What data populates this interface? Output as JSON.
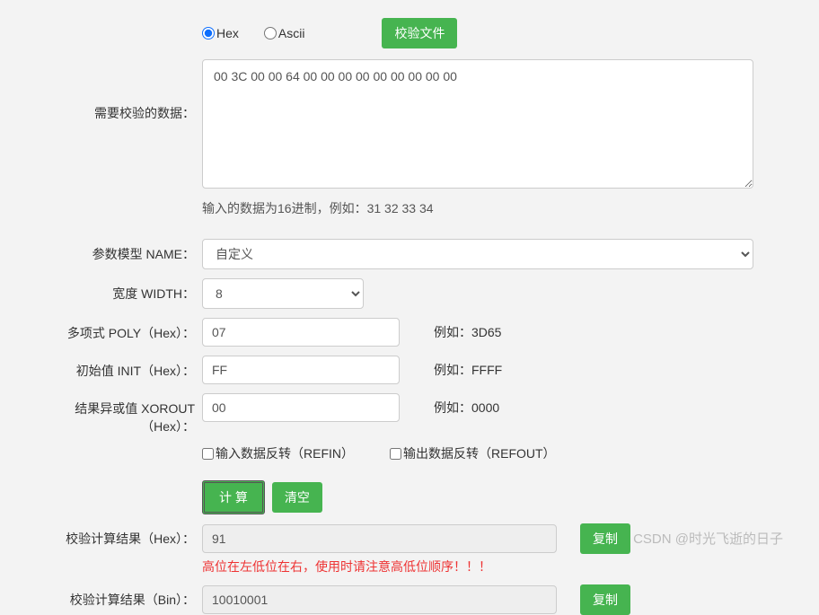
{
  "format": {
    "hex_label": "Hex",
    "ascii_label": "Ascii",
    "selected": "hex",
    "verify_file_button": "校验文件"
  },
  "input": {
    "label": "需要校验的数据：",
    "value": "00 3C 00 00 64 00 00 00 00 00 00 00 00 00",
    "hint": "输入的数据为16进制，例如：31 32 33 34"
  },
  "params": {
    "name_label": "参数模型 NAME：",
    "name_value": "自定义",
    "width_label": "宽度 WIDTH：",
    "width_value": "8",
    "poly_label": "多项式 POLY（Hex）：",
    "poly_value": "07",
    "poly_example": "例如：3D65",
    "init_label": "初始值 INIT（Hex）：",
    "init_value": "FF",
    "init_example": "例如：FFFF",
    "xorout_label": "结果异或值 XOROUT（Hex）：",
    "xorout_value": "00",
    "xorout_example": "例如：0000",
    "refin_label": "输入数据反转（REFIN）",
    "refout_label": "输出数据反转（REFOUT）"
  },
  "actions": {
    "calc_button": "计 算",
    "clear_button": "清空"
  },
  "results": {
    "hex_label": "校验计算结果（Hex）：",
    "hex_value": "91",
    "bin_label": "校验计算结果（Bin）：",
    "bin_value": "10010001",
    "copy_button": "复制",
    "warning": "高位在左低位在右，使用时请注意高低位顺序！！！"
  },
  "watermark": "CSDN @时光飞逝的日子"
}
